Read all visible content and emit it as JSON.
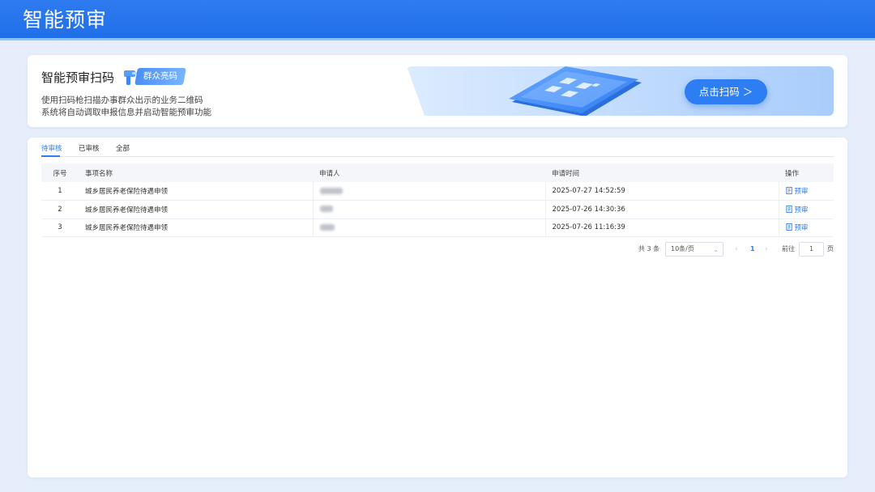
{
  "header": {
    "title": "智能预审"
  },
  "scan_card": {
    "title": "智能预审扫码",
    "badge": "群众亮码",
    "desc_line1": "使用扫码枪扫描办事群众出示的业务二维码",
    "desc_line2": "系统将自动调取申报信息并启动智能预审功能",
    "button": "点击扫码 ＞",
    "icons": {
      "scanner": "barcode-scanner-icon",
      "banner": "phone-qr-icon"
    }
  },
  "tabs": [
    {
      "label": "待审核",
      "active": true
    },
    {
      "label": "已审核",
      "active": false
    },
    {
      "label": "全部",
      "active": false
    }
  ],
  "table": {
    "headers": [
      "序号",
      "事项名称",
      "申请人",
      "申请时间",
      "操作"
    ],
    "rows": [
      {
        "no": "1",
        "name": "城乡居民养老保险待遇申领",
        "applicant": "",
        "time": "2025-07-27 14:52:59",
        "action": "预审"
      },
      {
        "no": "2",
        "name": "城乡居民养老保险待遇申领",
        "applicant": "",
        "time": "2025-07-26 14:30:36",
        "action": "预审"
      },
      {
        "no": "3",
        "name": "城乡居民养老保险待遇申领",
        "applicant": "",
        "time": "2025-07-26 11:16:39",
        "action": "预审"
      }
    ]
  },
  "pagination": {
    "total": "共 3 条",
    "page_size": "10条/页",
    "current_page": "1",
    "goto_label": "前往",
    "goto_value": "1",
    "unit": "页"
  },
  "colors": {
    "primary": "#2f7bf0",
    "header_bg": "#1f6fe9",
    "page_bg": "#e6eefb"
  }
}
